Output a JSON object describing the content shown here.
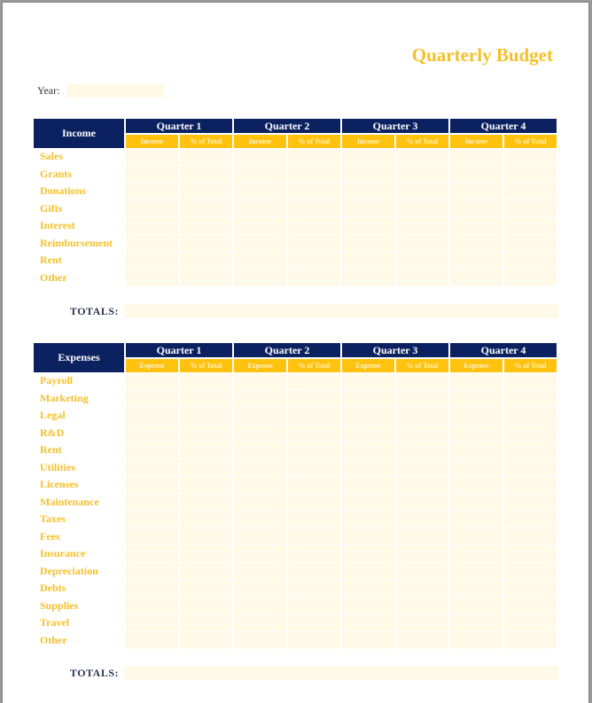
{
  "title": "Quarterly Budget",
  "year": {
    "label": "Year:",
    "value": ""
  },
  "colors": {
    "navy": "#0B2160",
    "gold": "#FFC20E",
    "label_gold": "#F5C02A",
    "cell_fill": "#FFF9E8"
  },
  "income": {
    "header": "Income",
    "quarters": [
      "Quarter 1",
      "Quarter 2",
      "Quarter 3",
      "Quarter 4"
    ],
    "subheaders": [
      "Income",
      "% of Total"
    ],
    "rows": [
      "Sales",
      "Grants",
      "Donations",
      "Gifts",
      "Interest",
      "Reimbursement",
      "Rent",
      "Other"
    ],
    "totals_label": "TOTALS:"
  },
  "expenses": {
    "header": "Expenses",
    "quarters": [
      "Quarter 1",
      "Quarter 2",
      "Quarter 3",
      "Quarter 4"
    ],
    "subheaders": [
      "Expense",
      "% of Total"
    ],
    "rows": [
      "Payroll",
      "Marketing",
      "Legal",
      "R&D",
      "Rent",
      "Utilities",
      "Licenses",
      "Maintenance",
      "Taxes",
      "Fees",
      "Insurance",
      "Depreciation",
      "Debts",
      "Supplies",
      "Travel",
      "Other"
    ],
    "totals_label": "TOTALS:"
  }
}
